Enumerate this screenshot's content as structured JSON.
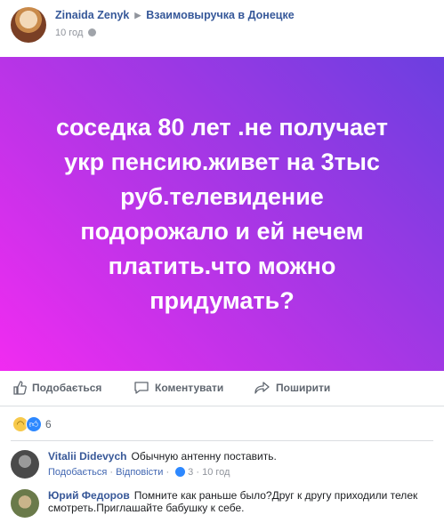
{
  "post": {
    "author": "Zinaida Zenyk",
    "group": "Взаимовыручка в Донецке",
    "time": "10 год",
    "text": "соседка 80 лет .не получает\nукр пенсию.живет на 3тыс\nруб.телевидение\nподорожало и ей нечем\nплатить.что можно\nпридумать?",
    "colors": {
      "gradient_start": "#f12bf1",
      "gradient_end": "#6b3fe0",
      "text": "#ffffff"
    }
  },
  "actions": {
    "like_label": "Подобається",
    "comment_label": "Коментувати",
    "share_label": "Поширити"
  },
  "reactions": {
    "icons": [
      "sad-icon",
      "like-icon"
    ],
    "count": "6"
  },
  "comments": [
    {
      "author": "Vitalii Didevych",
      "text": "Обычную антенну поставить.",
      "like_label": "Подобається",
      "reply_label": "Відповісти",
      "likes": "3",
      "time": "10 год"
    },
    {
      "author": "Юрий Федоров",
      "text": "Помните как раньше было?Друг к другу приходили телек смотреть.Приглашайте бабушку к себе."
    }
  ]
}
